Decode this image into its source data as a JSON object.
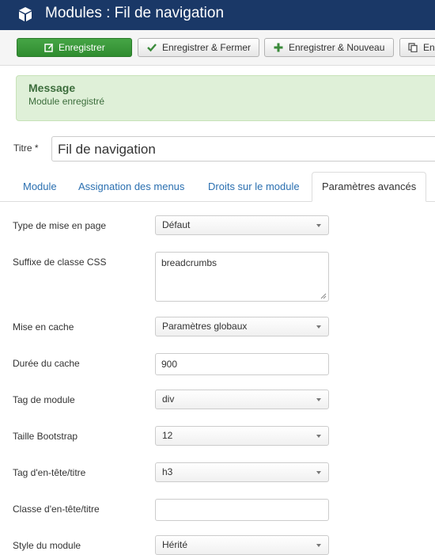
{
  "header": {
    "title": "Modules : Fil de navigation",
    "icon": "cube-icon",
    "bg_color": "#1a3867"
  },
  "toolbar": {
    "save_label": "Enregistrer",
    "save_close_label": "Enregistrer & Fermer",
    "save_new_label": "Enregistrer & Nouveau",
    "save_copy_label": "En",
    "save_color": "#3a9a3a"
  },
  "message": {
    "heading": "Message",
    "text": "Module enregistré"
  },
  "title_field": {
    "label": "Titre *",
    "value": "Fil de navigation"
  },
  "tabs": [
    {
      "label": "Module"
    },
    {
      "label": "Assignation des menus"
    },
    {
      "label": "Droits sur le module"
    },
    {
      "label": "Paramètres avancés",
      "active": true
    }
  ],
  "form": {
    "layout": {
      "label": "Type de mise en page",
      "value": "Défaut"
    },
    "css_suffix": {
      "label": "Suffixe de classe CSS",
      "value": "breadcrumbs"
    },
    "caching": {
      "label": "Mise en cache",
      "value": "Paramètres globaux"
    },
    "cache_time": {
      "label": "Durée du cache",
      "value": "900"
    },
    "module_tag": {
      "label": "Tag de module",
      "value": "div"
    },
    "bootstrap_size": {
      "label": "Taille Bootstrap",
      "value": "12"
    },
    "header_tag": {
      "label": "Tag d'en-tête/titre",
      "value": "h3"
    },
    "header_class": {
      "label": "Classe d'en-tête/titre",
      "value": ""
    },
    "module_style": {
      "label": "Style du module",
      "value": "Hérité"
    }
  }
}
